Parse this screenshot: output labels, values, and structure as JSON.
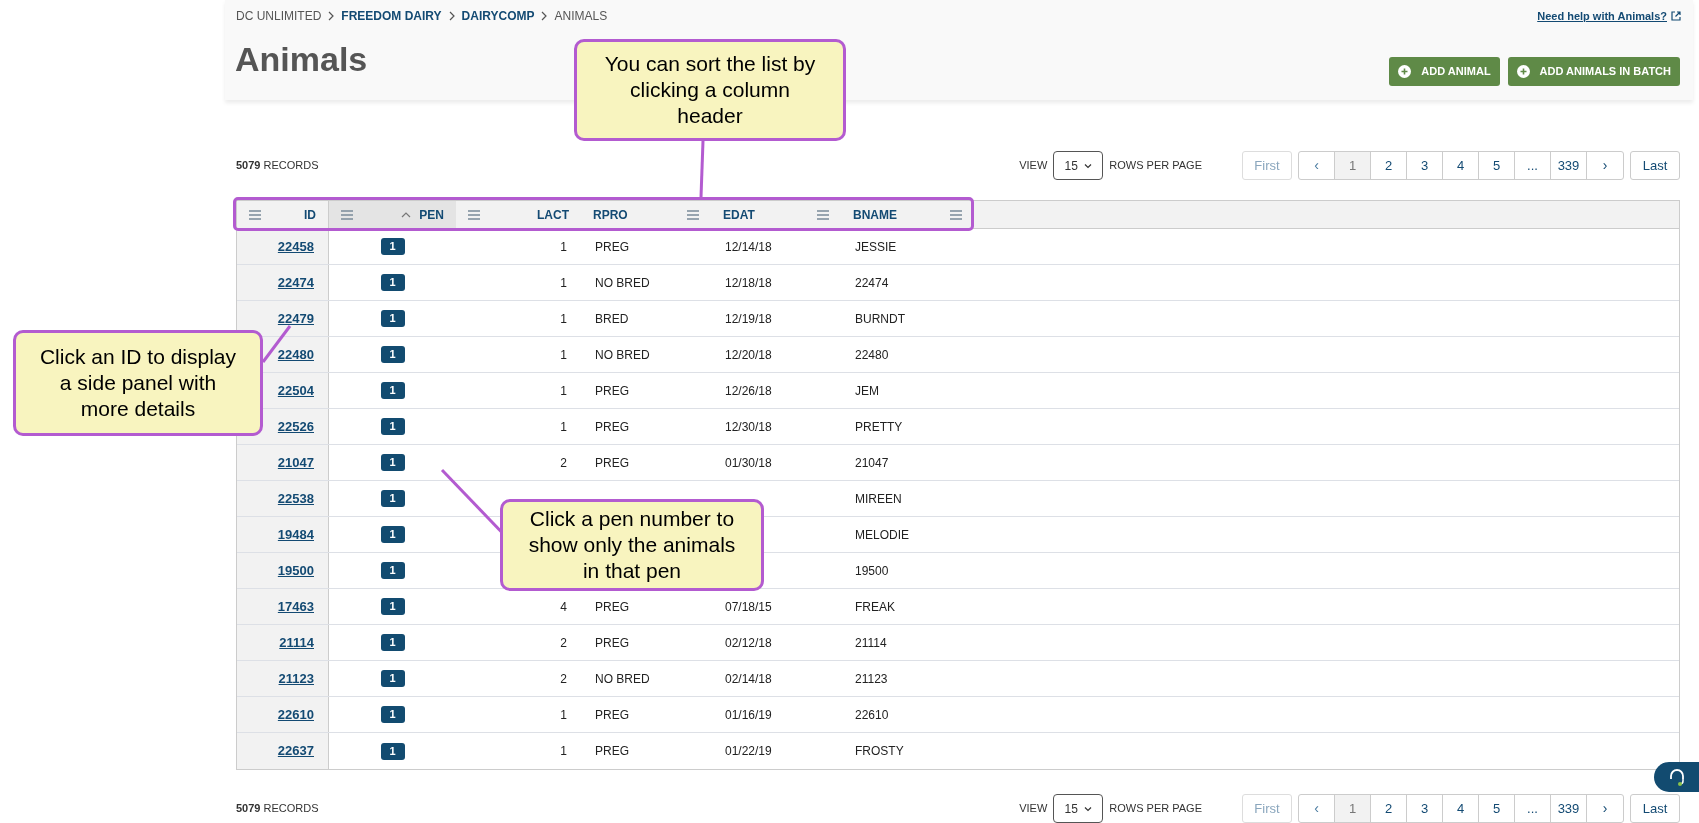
{
  "breadcrumb": [
    {
      "label": "DC UNLIMITED",
      "link": false
    },
    {
      "label": "FREEDOM DAIRY",
      "link": true
    },
    {
      "label": "DAIRYCOMP",
      "link": true
    },
    {
      "label": "ANIMALS",
      "link": false
    }
  ],
  "help_link": "Need help with Animals?",
  "title": "Animals",
  "actions": [
    "ADD ANIMAL",
    "ADD ANIMALS IN BATCH"
  ],
  "toolbars": [
    {
      "records": "**5079** RECORDS",
      "view": "VIEW",
      "rows_value": "15",
      "rows_label": "ROWS PER PAGE",
      "first": "First",
      "first_disabled": true,
      "prev": "‹",
      "pages": [
        {
          "label": "1",
          "selected": true
        },
        {
          "label": "2",
          "selected": false
        },
        {
          "label": "3",
          "selected": false
        },
        {
          "label": "4",
          "selected": false
        },
        {
          "label": "5",
          "selected": false
        },
        {
          "label": "...",
          "selected": false
        },
        {
          "label": "339",
          "selected": false
        }
      ],
      "next": "›",
      "last": "Last"
    },
    {
      "records": "**5079** RECORDS",
      "view": "VIEW",
      "rows_value": "15",
      "rows_label": "ROWS PER PAGE",
      "first": "First",
      "first_disabled": true,
      "prev": "‹",
      "pages": [
        {
          "label": "1",
          "selected": true
        },
        {
          "label": "2",
          "selected": false
        },
        {
          "label": "3",
          "selected": false
        },
        {
          "label": "4",
          "selected": false
        },
        {
          "label": "5",
          "selected": false
        },
        {
          "label": "...",
          "selected": false
        },
        {
          "label": "339",
          "selected": false
        }
      ],
      "next": "›",
      "last": "Last"
    }
  ],
  "table": {
    "columns": [
      {
        "label": "ID",
        "sorted": false
      },
      {
        "label": "PEN",
        "sorted": true
      },
      {
        "label": "LACT",
        "sorted": false
      },
      {
        "label": "RPRO",
        "sorted": false
      },
      {
        "label": "EDAT",
        "sorted": false
      },
      {
        "label": "BNAME",
        "sorted": false
      }
    ],
    "rows": [
      {
        "id": "22458",
        "pen": "1",
        "lact": "1",
        "rpro": "PREG",
        "edat": "12/14/18",
        "bname": "JESSIE"
      },
      {
        "id": "22474",
        "pen": "1",
        "lact": "1",
        "rpro": "NO BRED",
        "edat": "12/18/18",
        "bname": "22474"
      },
      {
        "id": "22479",
        "pen": "1",
        "lact": "1",
        "rpro": "BRED",
        "edat": "12/19/18",
        "bname": "BURNDT"
      },
      {
        "id": "22480",
        "pen": "1",
        "lact": "1",
        "rpro": "NO BRED",
        "edat": "12/20/18",
        "bname": "22480"
      },
      {
        "id": "22504",
        "pen": "1",
        "lact": "1",
        "rpro": "PREG",
        "edat": "12/26/18",
        "bname": "JEM"
      },
      {
        "id": "22526",
        "pen": "1",
        "lact": "1",
        "rpro": "PREG",
        "edat": "12/30/18",
        "bname": "PRETTY"
      },
      {
        "id": "21047",
        "pen": "1",
        "lact": "2",
        "rpro": "PREG",
        "edat": "01/30/18",
        "bname": "21047"
      },
      {
        "id": "22538",
        "pen": "1",
        "bname": "MIREEN"
      },
      {
        "id": "19484",
        "pen": "1",
        "bname": "MELODIE"
      },
      {
        "id": "19500",
        "pen": "1",
        "bname": "19500"
      },
      {
        "id": "17463",
        "pen": "1",
        "lact": "4",
        "rpro": "PREG",
        "edat": "07/18/15",
        "bname": "FREAK"
      },
      {
        "id": "21114",
        "pen": "1",
        "lact": "2",
        "rpro": "PREG",
        "edat": "02/12/18",
        "bname": "21114"
      },
      {
        "id": "21123",
        "pen": "1",
        "lact": "2",
        "rpro": "NO BRED",
        "edat": "02/14/18",
        "bname": "21123"
      },
      {
        "id": "22610",
        "pen": "1",
        "lact": "1",
        "rpro": "PREG",
        "edat": "01/16/19",
        "bname": "22610"
      },
      {
        "id": "22637",
        "pen": "1",
        "lact": "1",
        "rpro": "PREG",
        "edat": "01/22/19",
        "bname": "FROSTY"
      }
    ]
  },
  "callouts": [
    "You can sort the list by clicking a column header",
    "Click an ID to display a side panel with more details",
    "Click a pen number to show only the animals in that pen"
  ]
}
